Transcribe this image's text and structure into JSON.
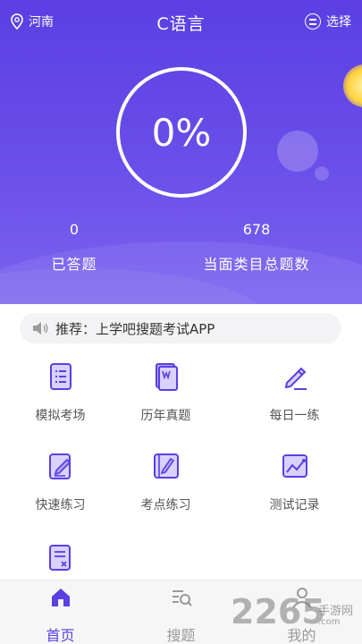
{
  "header": {
    "location": "河南",
    "title": "C语言",
    "select_label": "选择"
  },
  "progress": {
    "percent_text": "0%",
    "answered_count": "0",
    "answered_label": "已答题",
    "total_count": "678",
    "total_label": "当面类目总题数"
  },
  "notice": {
    "text": "推荐：上学吧搜题考试APP"
  },
  "grid": {
    "items": [
      {
        "label": "模拟考场",
        "icon": "list-document-icon"
      },
      {
        "label": "历年真题",
        "icon": "book-icon"
      },
      {
        "label": "每日一练",
        "icon": "pencil-icon"
      },
      {
        "label": "快速练习",
        "icon": "edit-document-icon"
      },
      {
        "label": "考点练习",
        "icon": "notebook-pen-icon"
      },
      {
        "label": "测试记录",
        "icon": "chart-record-icon"
      },
      {
        "label": "",
        "icon": "wrong-answers-icon"
      }
    ]
  },
  "tabbar": {
    "tabs": [
      {
        "label": "首页",
        "icon": "home-icon",
        "active": true
      },
      {
        "label": "搜题",
        "icon": "search-list-icon",
        "active": false
      },
      {
        "label": "我的",
        "icon": "user-icon",
        "active": false
      }
    ]
  },
  "watermark": {
    "number": "2265",
    "site": "手游网",
    "domain": ".com"
  },
  "colors": {
    "primary": "#5b3fe3",
    "icon_accent": "#6a4fea",
    "tab_inactive": "#999999"
  }
}
